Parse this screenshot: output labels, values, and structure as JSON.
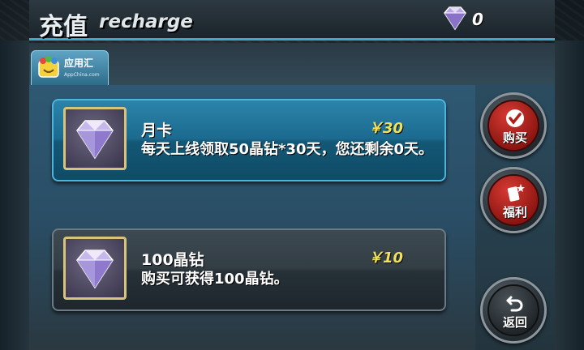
{
  "header": {
    "title": "充值",
    "subtitle": "recharge",
    "balance_icon": "diamond-icon",
    "balance": "0"
  },
  "tab": {
    "label": "应用汇",
    "url": "AppChina.com",
    "icon": "appchina-logo-icon"
  },
  "items": [
    {
      "title": "月卡",
      "price": "￥30",
      "description": "每天上线领取50晶钻*30天，您还剩余0天。",
      "icon": "diamond-icon"
    },
    {
      "title": "100晶钻",
      "price": "￥10",
      "description": "购买可获得100晶钻。",
      "icon": "diamond-icon"
    }
  ],
  "side_buttons": {
    "buy": {
      "label": "购买",
      "icon": "checkmark-icon"
    },
    "welfare": {
      "label": "福利",
      "icon": "card-star-icon"
    },
    "back": {
      "label": "返回",
      "icon": "return-arrow-icon"
    }
  },
  "colors": {
    "accent": "#3fa9c9",
    "price": "#f2e15a",
    "button_red": "#c2271f"
  }
}
